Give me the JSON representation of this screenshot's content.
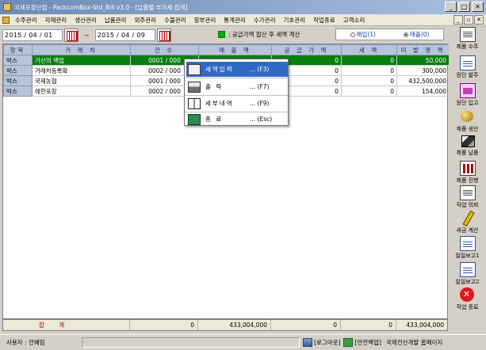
{
  "window": {
    "title": "국제포장산업 - PackcomBox-Std_Bill v3.0 - [납품별 부가세 집계]",
    "controls": [
      "_",
      "□",
      "✕"
    ]
  },
  "menu": [
    "수주관리",
    "자재관리",
    "생산관리",
    "납품관리",
    "외주관리",
    "수불관리",
    "장부관리",
    "통계관리",
    "수가관리",
    "기초관리",
    "작업종료",
    "고객소리"
  ],
  "mdi_controls": [
    "_",
    "▫",
    "✕"
  ],
  "filter": {
    "date_from": "2015 / 04 / 01",
    "date_to": "2015 / 04 / 09",
    "tilde": "~",
    "legend_text": ": 공급가액 합산 후 세액 계산",
    "radio_buy": "매입(1)",
    "radio_sell": "매출(0)",
    "radio_selected": "sell"
  },
  "table": {
    "columns": [
      "항목",
      "거 래 처",
      "건 수",
      "매 출 액",
      "공 급 가 액",
      "세 액",
      "미 발 행 액"
    ],
    "rows": [
      {
        "kind": "박스",
        "client": "가산의 백업",
        "count": "0001 / 000",
        "sales": "",
        "supply": "0",
        "tax": "0",
        "unissued": "50,000",
        "selected": true
      },
      {
        "kind": "박스",
        "client": "거래처등록확",
        "count": "0002 / 000",
        "sales": "",
        "supply": "0",
        "tax": "0",
        "unissued": "300,000",
        "selected": false
      },
      {
        "kind": "박스",
        "client": "국제농협",
        "count": "0001 / 000",
        "sales": "",
        "supply": "0",
        "tax": "0",
        "unissued": "432,500,000",
        "selected": false
      },
      {
        "kind": "박스",
        "client": "에한포장",
        "count": "0002 / 000",
        "sales": "",
        "supply": "0",
        "tax": "0",
        "unissued": "154,000",
        "selected": false
      }
    ]
  },
  "totals": {
    "label": "합 계",
    "count": "0",
    "sales": "433,004,000",
    "supply": "0",
    "tax": "0",
    "unissued": "433,004,000"
  },
  "context_menu": [
    {
      "icon": "clipboard-icon",
      "label": "세액입력",
      "key": "... (F3)",
      "highlighted": true
    },
    {
      "icon": "printer-icon",
      "label": "출 력",
      "key": "... (F7)",
      "highlighted": false
    },
    {
      "icon": "book-icon",
      "label": "세부내역",
      "key": "... (F9)",
      "highlighted": false
    },
    {
      "icon": "exit-door-icon",
      "label": "종 료",
      "key": "... (Esc)",
      "highlighted": false
    }
  ],
  "sidebar": [
    {
      "label": "제품 수주",
      "icon": "order-doc-icon"
    },
    {
      "label": "원단 발주",
      "icon": "purchase-doc-icon"
    },
    {
      "label": "원단 입고",
      "icon": "receive-icon"
    },
    {
      "label": "제품 생산",
      "icon": "production-icon"
    },
    {
      "label": "제품 납품",
      "icon": "delivery-box-icon"
    },
    {
      "label": "제품 진행",
      "icon": "progress-chart-icon"
    },
    {
      "label": "작업 의뢰",
      "icon": "request-doc-icon"
    },
    {
      "label": "세금 계산",
      "icon": "tax-pencil-icon"
    },
    {
      "label": "일일보고1",
      "icon": "daily-report-icon"
    },
    {
      "label": "일일보고2",
      "icon": "daily-report-chart-icon"
    },
    {
      "label": "작업 종료",
      "icon": "exit-icon"
    }
  ],
  "status": {
    "user": "사용자 : 전혜림",
    "logout": "[로그아웃]",
    "backup": "[안전백업]",
    "company": "국제전산개발 홈페이지"
  }
}
